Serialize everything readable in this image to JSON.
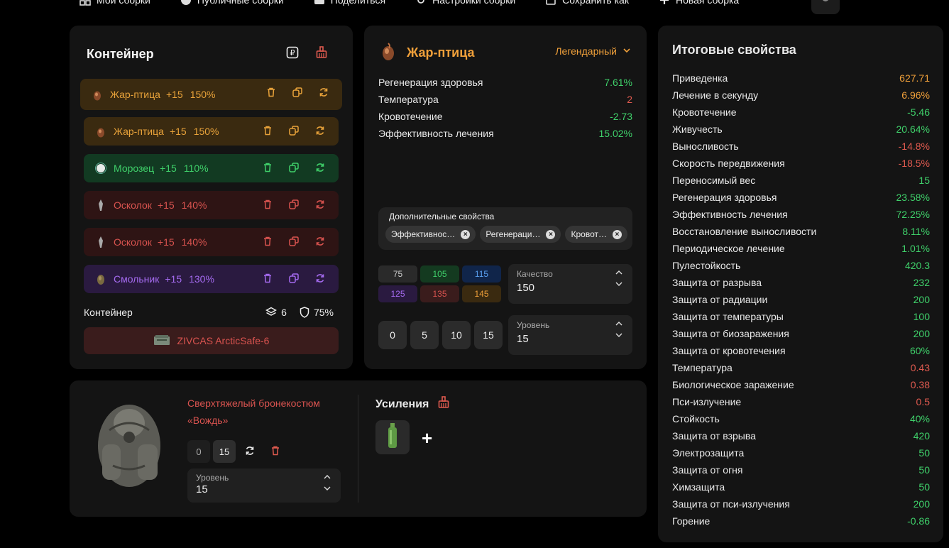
{
  "nav": {
    "my_builds": "Мои сборки",
    "public_builds": "Публичные сборки",
    "share": "Поделиться",
    "build_settings": "Настройки сборки",
    "save_as": "Сохранить как",
    "new_build": "Новая сборка"
  },
  "container": {
    "title": "Контейнер",
    "artifacts": [
      {
        "name": "Жар-птица",
        "level": "+15",
        "quality": "150%",
        "color": "orange"
      },
      {
        "name": "Жар-птица",
        "level": "+15",
        "quality": "150%",
        "color": "orange"
      },
      {
        "name": "Морозец",
        "level": "+15",
        "quality": "110%",
        "color": "green"
      },
      {
        "name": "Осколок",
        "level": "+15",
        "quality": "140%",
        "color": "red"
      },
      {
        "name": "Осколок",
        "level": "+15",
        "quality": "140%",
        "color": "red"
      },
      {
        "name": "Смольник",
        "level": "+15",
        "quality": "130%",
        "color": "purple"
      }
    ],
    "footer_label": "Контейнер",
    "slots": "6",
    "protection": "75%",
    "container_name": "ZIVCAS ArcticSafe-6"
  },
  "artifact": {
    "name": "Жар-птица",
    "rarity": "Легендарный",
    "properties": [
      {
        "name": "Регенерация здоровья",
        "value": "7.61%",
        "tone": "pos"
      },
      {
        "name": "Температура",
        "value": "2",
        "tone": "neg"
      },
      {
        "name": "Кровотечение",
        "value": "-2.73",
        "tone": "pos"
      },
      {
        "name": "Эффективность лечения",
        "value": "15.02%",
        "tone": "pos"
      }
    ],
    "extra_title": "Дополнительные свойства",
    "extra_chips": [
      "Эффективнос…",
      "Регенераци…",
      "Кровот…"
    ],
    "quality_presets": [
      {
        "value": "75",
        "bg": "#2a2a2a",
        "fg": "#cfcfcf"
      },
      {
        "value": "105",
        "bg": "#143a20",
        "fg": "#3fd06a"
      },
      {
        "value": "115",
        "bg": "#10254a",
        "fg": "#5aa0f0"
      },
      {
        "value": "125",
        "bg": "#2a1a40",
        "fg": "#a56bf0"
      },
      {
        "value": "135",
        "bg": "#3a1c1c",
        "fg": "#d9534f"
      },
      {
        "value": "145",
        "bg": "#3a2a10",
        "fg": "#f0a03a"
      }
    ],
    "quality_label": "Качество",
    "quality_value": "150",
    "level_presets": [
      "0",
      "5",
      "10",
      "15"
    ],
    "level_label": "Уровень",
    "level_value": "15"
  },
  "armor": {
    "name": "Сверхтяжелый бронекостюм «Вождь»",
    "min_level": "0",
    "max_level": "15",
    "level_label": "Уровень",
    "level_value": "15",
    "boosts_title": "Усиления",
    "add_label": "+"
  },
  "summary": {
    "title": "Итоговые свойства",
    "rows": [
      {
        "name": "Приведенка",
        "value": "627.71",
        "tone": "warn"
      },
      {
        "name": "Лечение в секунду",
        "value": "6.96%",
        "tone": "warn"
      },
      {
        "name": "Кровотечение",
        "value": "-5.46",
        "tone": "pos"
      },
      {
        "name": "Живучесть",
        "value": "20.64%",
        "tone": "pos"
      },
      {
        "name": "Выносливость",
        "value": "-14.8%",
        "tone": "neg"
      },
      {
        "name": "Скорость передвижения",
        "value": "-18.5%",
        "tone": "neg"
      },
      {
        "name": "Переносимый вес",
        "value": "15",
        "tone": "pos"
      },
      {
        "name": "Регенерация здоровья",
        "value": "23.58%",
        "tone": "pos"
      },
      {
        "name": "Эффективность лечения",
        "value": "72.25%",
        "tone": "pos"
      },
      {
        "name": "Восстановление выносливости",
        "value": "8.11%",
        "tone": "pos"
      },
      {
        "name": "Периодическое лечение",
        "value": "1.01%",
        "tone": "pos"
      },
      {
        "name": "Пулестойкость",
        "value": "420.3",
        "tone": "pos"
      },
      {
        "name": "Защита от разрыва",
        "value": "232",
        "tone": "pos"
      },
      {
        "name": "Защита от радиации",
        "value": "200",
        "tone": "pos"
      },
      {
        "name": "Защита от температуры",
        "value": "100",
        "tone": "pos"
      },
      {
        "name": "Защита от биозаражения",
        "value": "200",
        "tone": "pos"
      },
      {
        "name": "Защита от кровотечения",
        "value": "60%",
        "tone": "pos"
      },
      {
        "name": "Температура",
        "value": "0.43",
        "tone": "neg"
      },
      {
        "name": "Биологическое заражение",
        "value": "0.38",
        "tone": "neg"
      },
      {
        "name": "Пси-излучение",
        "value": "0.5",
        "tone": "neg"
      },
      {
        "name": "Стойкость",
        "value": "40%",
        "tone": "pos"
      },
      {
        "name": "Защита от взрыва",
        "value": "420",
        "tone": "pos"
      },
      {
        "name": "Электрозащита",
        "value": "50",
        "tone": "pos"
      },
      {
        "name": "Защита от огня",
        "value": "50",
        "tone": "pos"
      },
      {
        "name": "Химзащита",
        "value": "50",
        "tone": "pos"
      },
      {
        "name": "Защита от пси-излучения",
        "value": "200",
        "tone": "pos"
      },
      {
        "name": "Горение",
        "value": "-0.86",
        "tone": "pos"
      }
    ]
  }
}
